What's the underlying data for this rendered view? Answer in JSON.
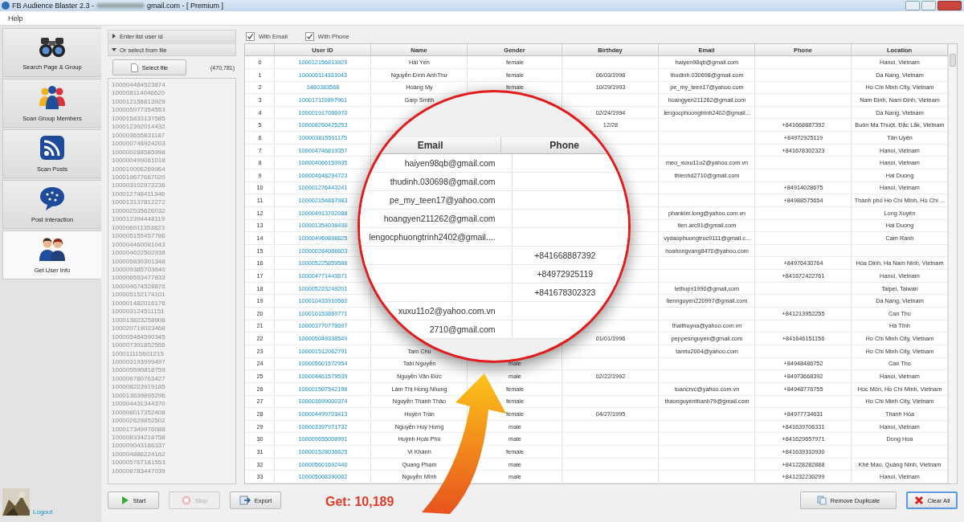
{
  "window": {
    "title": "FB Audience Blaster 2.3 -",
    "title_suffix": "gmail.com - [ Premium ]"
  },
  "menu": [
    "Help"
  ],
  "sidebar": {
    "items": [
      {
        "label": "Search Page & Group",
        "selected": false
      },
      {
        "label": "Scan Group Members",
        "selected": false
      },
      {
        "label": "Scan Posts",
        "selected": false
      },
      {
        "label": "Post Interaction",
        "selected": false
      },
      {
        "label": "Get User Info",
        "selected": true
      }
    ],
    "logout": "Logout"
  },
  "source": {
    "sections": [
      {
        "label": "Enter list user id",
        "expanded": false
      },
      {
        "label": "Or select from file",
        "expanded": true
      }
    ],
    "select_button": "Select file",
    "count": "(470,781)",
    "ids": [
      "100004484523874",
      "100008114046620",
      "100012156813929",
      "100005977354553",
      "100015833137585",
      "100012392014432",
      "100003655831187",
      "100000746924203",
      "100000288585998",
      "100000499061018",
      "100010006269964",
      "100010677667020",
      "100003102972236",
      "100012748411346",
      "100013137812272",
      "100002535626032",
      "100012394448119",
      "100006911353823",
      "100005155457786",
      "100004460081043",
      "100004622502938",
      "100005830301348",
      "100009385703640",
      "100006593477833",
      "100004674528876",
      "100005152174101",
      "100001482016176",
      "100003124511151",
      "100013823258908",
      "100020719023468",
      "100005464590345",
      "100007391852555",
      "100011115601215",
      "100003193999497",
      "100005590818759",
      "100006780763427",
      "100008223919185",
      "100013639895296",
      "100004431344370",
      "100008017352408",
      "100002629852502",
      "100017349976088",
      "100008334218758",
      "100009043186337",
      "100004886224162",
      "100005767181553",
      "100008783447039"
    ]
  },
  "filters": [
    {
      "label": "With Email",
      "checked": true
    },
    {
      "label": "With Phone",
      "checked": true
    }
  ],
  "table": {
    "columns": [
      "User ID",
      "Name",
      "Gender",
      "Birthday",
      "Email",
      "Phone",
      "Location"
    ],
    "rows": [
      {
        "index": "0",
        "user_id": "100012156813929",
        "name": "Hải Yến",
        "gender": "female",
        "email": "haiyen98qb@gmail.com",
        "location": "Hanoi, Vietnam"
      },
      {
        "index": "1",
        "user_id": "100006114331043",
        "name": "Nguyễn Đình AnhThư",
        "gender": "female",
        "birthday": "06/03/1998",
        "email": "thudinh.030698@gmail.com",
        "location": "Da Nang, Vietnam"
      },
      {
        "index": "2",
        "user_id": "1480383568",
        "name": "Hoàng My",
        "gender": "female",
        "birthday": "10/29/1993",
        "email": "pe_my_teen17@yahoo.com",
        "location": "Ho Chi Minh City, Vietnam"
      },
      {
        "index": "3",
        "user_id": "100017110897961",
        "name": "Garp Smith",
        "email": "hoangyen211262@gmail.com",
        "location": "Nam Định, Nam Định, Vietnam"
      },
      {
        "index": "4",
        "user_id": "100001917086970",
        "birthday": "02/24/1994",
        "email": "lengocphuongtrinh2402@gmail...",
        "location": "Da Nang, Vietnam"
      },
      {
        "index": "5",
        "user_id": "100008260425253",
        "birthday": "12/28",
        "phone": "+841668887392",
        "location": "Buôn Ma Thuột, Đắc Lắk, Vietnam"
      },
      {
        "index": "6",
        "user_id": "100003815591175",
        "phone": "+84972925119",
        "location": "Tân Uyên"
      },
      {
        "index": "7",
        "user_id": "100004746819357",
        "phone": "+841678302323",
        "location": "Hanoi, Vietnam"
      },
      {
        "index": "8",
        "user_id": "100004066153935",
        "email": "meo_xuxu11o2@yahoo.com.vn",
        "location": "Hanoi, Vietnam"
      },
      {
        "index": "9",
        "user_id": "100004648294723",
        "email": "thienhd2710@gmail.com",
        "location": "Hai Duong"
      },
      {
        "index": "10",
        "user_id": "100001276443241",
        "phone": "+84914028675",
        "location": "Hanoi, Vietnam"
      },
      {
        "index": "11",
        "user_id": "100002154867983",
        "phone": "+84988575654",
        "location": "Thành phố Hồ Chí Minh, Hồ Chí ..."
      },
      {
        "index": "12",
        "user_id": "100004913702088",
        "email": "phankim.long@yahoo.com.vn",
        "location": "Long Xuyên"
      },
      {
        "index": "13",
        "user_id": "100001354038430",
        "email": "tien.arc91@gmail.com",
        "location": "Hai Duong"
      },
      {
        "index": "14",
        "user_id": "100004969898625",
        "email": "vydaophuongtruc9111@gmail.c...",
        "location": "Cam Ranh"
      },
      {
        "index": "15",
        "user_id": "100000284088603",
        "email": "hoahongvang8470@yahoo.com"
      },
      {
        "index": "16",
        "user_id": "100005225859586",
        "phone": "+84976430764",
        "location": "Hòa Dinh, Ha Nam Ninh, Vietnam"
      },
      {
        "index": "17",
        "user_id": "100004771443671",
        "phone": "+841672422761",
        "location": "Hanoi, Vietnam"
      },
      {
        "index": "18",
        "user_id": "100005223249201",
        "email": "lethupx1990@gmail.com",
        "location": "Taipei, Taiwan"
      },
      {
        "index": "19",
        "user_id": "100010433910560",
        "email": "tiennguyen220997@gmail.com",
        "location": "Da Nang, Vietnam"
      },
      {
        "index": "20",
        "user_id": "100010153869771",
        "phone": "+841213952255",
        "location": "Can Tho"
      },
      {
        "index": "21",
        "user_id": "100003770778697",
        "email": "thaithuyna@yahoo.com.vn",
        "location": "Hà Tĩnh"
      },
      {
        "index": "22",
        "user_id": "100005049338549",
        "birthday": "01/01/1996",
        "email": "peppesnguyen@gmail.com",
        "phone": "+841646151156",
        "location": "Ho Chi Minh City, Vietnam"
      },
      {
        "index": "23",
        "user_id": "100001512062791",
        "name": "Tam Chu",
        "email": "tamtu2004@yahoo.com",
        "location": "Ho Chi Minh City, Vietnam"
      },
      {
        "index": "24",
        "user_id": "100005601572954",
        "name": "Tabi Nguyễn",
        "gender": "male",
        "phone": "+84948486752",
        "location": "Can Tho"
      },
      {
        "index": "25",
        "user_id": "100004461579539",
        "name": "Nguyễn Văn Đức",
        "gender": "male",
        "birthday": "02/22/1992",
        "phone": "+84973668392",
        "location": "Hanoi, Vietnam"
      },
      {
        "index": "26",
        "user_id": "100001507542198",
        "name": "Lâm Thị Hồng Nhung",
        "gender": "female",
        "email": "tuancrvc@yahoo.com.vn",
        "phone": "+84948776755",
        "location": "Hóc Môn, Hồ Chí Minh, Vietnam"
      },
      {
        "index": "27",
        "user_id": "100003699000374",
        "name": "Nguyễn Thanh Thảo",
        "gender": "female",
        "email": "thaonguyenthanh79@gmail.com",
        "location": "Ho Chi Minh City, Vietnam"
      },
      {
        "index": "28",
        "user_id": "100004499703413",
        "name": "Huyền Trần",
        "gender": "female",
        "birthday": "04/27/1995",
        "phone": "+84977734631",
        "location": "Thanh Hóa"
      },
      {
        "index": "29",
        "user_id": "100003397971732",
        "name": "Nguyễn Huy Hưng",
        "gender": "male",
        "phone": "+841639706331",
        "location": "Hanoi, Vietnam"
      },
      {
        "index": "30",
        "user_id": "100009655008991",
        "name": "Huỳnh Hoài Phú",
        "gender": "male",
        "phone": "+841629657971",
        "location": "Dong Hoa"
      },
      {
        "index": "31",
        "user_id": "100001528036625",
        "name": "Vi Khánh",
        "gender": "female",
        "phone": "+841639310930"
      },
      {
        "index": "32",
        "user_id": "100005601692440",
        "name": "Quang Phạm",
        "gender": "male",
        "phone": "+841228282888",
        "location": "Khê Mao, Quảng Ninh, Vietnam"
      },
      {
        "index": "33",
        "user_id": "100005008390082",
        "name": "Nguyễn Minh",
        "gender": "male",
        "phone": "+841232230299",
        "location": "Hanoi, Vietnam"
      }
    ]
  },
  "magnifier": {
    "columns": [
      "Email",
      "Phone"
    ],
    "rows": [
      {
        "email": "haiyen98qb@gmail.com"
      },
      {
        "email": "thudinh.030698@gmail.com"
      },
      {
        "email": "pe_my_teen17@yahoo.com"
      },
      {
        "email": "hoangyen211262@gmail.com"
      },
      {
        "email": "lengocphuongtrinh2402@gmail...."
      },
      {
        "phone": "+841668887392"
      },
      {
        "phone": "+84972925119"
      },
      {
        "phone": "+841678302323"
      },
      {
        "email": "xuxu11o2@yahoo.com.vn"
      },
      {
        "email": "2710@gmail.com"
      }
    ]
  },
  "actions": [
    {
      "label": "Start",
      "disabled": false
    },
    {
      "label": "Stop",
      "disabled": true
    },
    {
      "label": "Export",
      "disabled": false
    }
  ],
  "table_actions": [
    {
      "label": "Remove Duplicate",
      "focused": false
    },
    {
      "label": "Clear All",
      "focused": true
    }
  ],
  "callout": {
    "text": "Get: 10,189"
  }
}
